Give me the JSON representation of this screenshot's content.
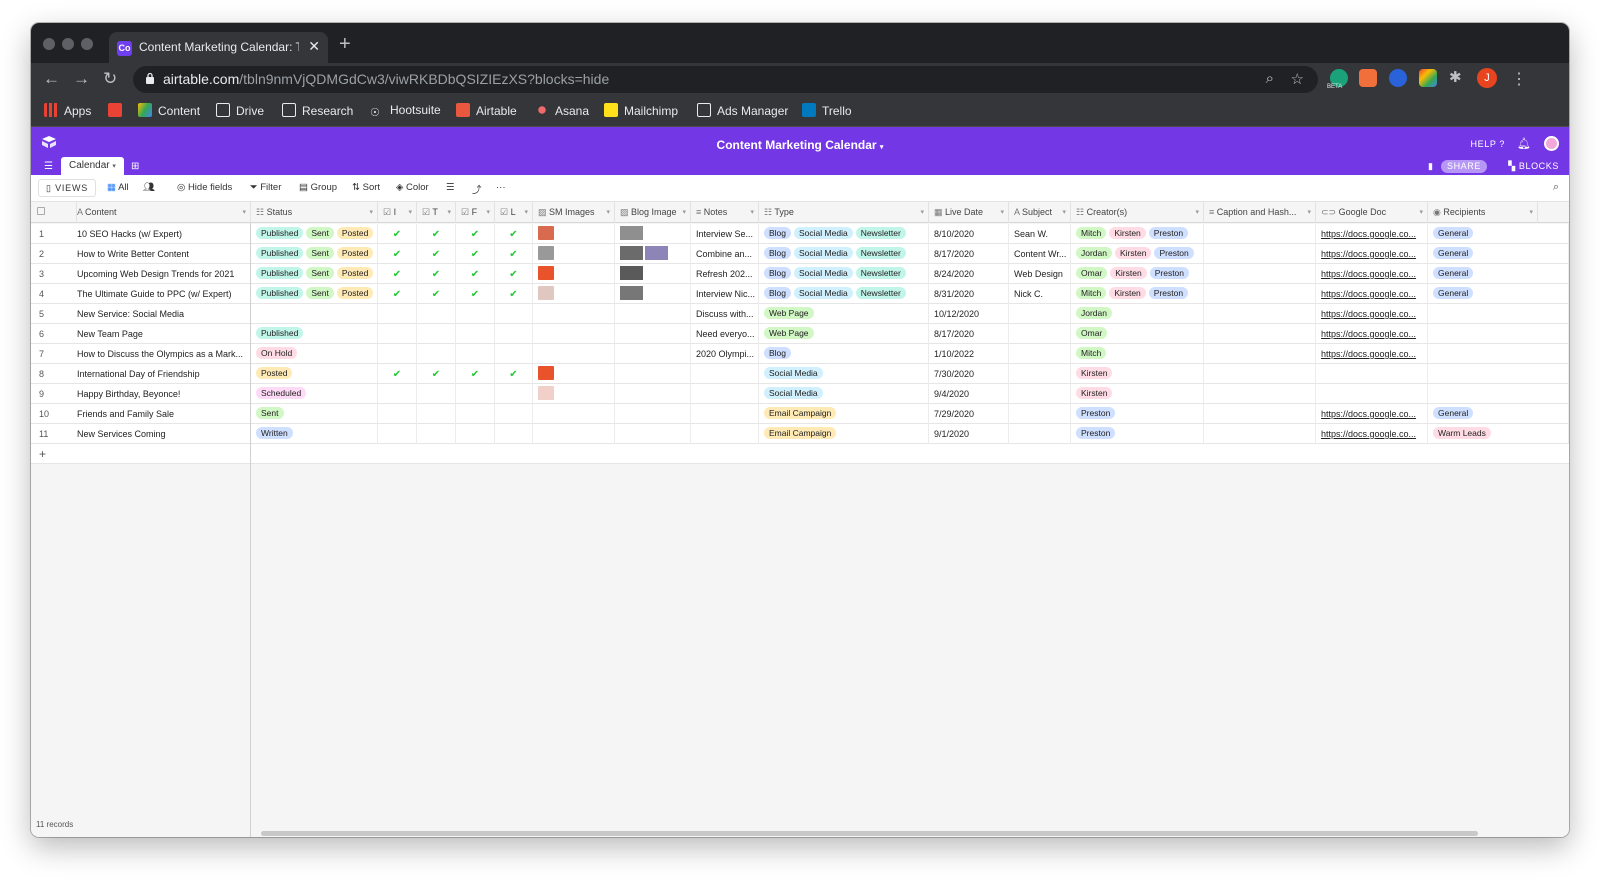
{
  "browser": {
    "tab_title": "Content Marketing Calendar: T",
    "tab_favicon": "Co",
    "url_host": "airtable.com",
    "url_path": "/tbln9nmVjQDMGdCw3/viwRKBDbQSIZIEzXS?blocks=hide",
    "profile_initial": "J",
    "ext_beta": "BETA",
    "bookmarks": [
      "Apps",
      "Content",
      "Drive",
      "Research",
      "Hootsuite",
      "Airtable",
      "Asana",
      "Mailchimp",
      "Ads Manager",
      "Trello"
    ]
  },
  "app": {
    "base_title": "Content Marketing Calendar",
    "help_label": "HELP",
    "table_tab": "Calendar",
    "share_label": "SHARE",
    "blocks_label": "BLOCKS",
    "accent": "#7437e6"
  },
  "viewbar": {
    "views_label": "VIEWS",
    "view_name": "All",
    "hide_fields": "Hide fields",
    "filter": "Filter",
    "group": "Group",
    "sort": "Sort",
    "color": "Color"
  },
  "columns": {
    "content": "Content",
    "status": "Status",
    "c_i": "I",
    "c_t": "T",
    "c_f": "F",
    "c_l": "L",
    "sm_images": "SM Images",
    "blog_image": "Blog Image",
    "notes": "Notes",
    "type": "Type",
    "live_date": "Live Date",
    "subject": "Subject",
    "creators": "Creator(s)",
    "caption": "Caption and Hash...",
    "google_doc": "Google Doc",
    "recipients": "Recipients"
  },
  "pill_colors": {
    "Published": "#c2f5e9",
    "Sent": "#d1f7c4",
    "Posted": "#ffeab6",
    "On Hold": "#ffdce5",
    "Scheduled": "#ffdaf6",
    "Written": "#cfdfff",
    "Blog": "#cfdfff",
    "Social Media": "#d0f0fd",
    "Newsletter": "#c2f5e9",
    "Web Page": "#d1f7c4",
    "Email Campaign": "#ffeab6",
    "Mitch": "#d1f7c4",
    "Kirsten": "#ffdce5",
    "Preston": "#cfdfff",
    "Jordan": "#d1f7c4",
    "Omar": "#d1f7c4",
    "General": "#cfdfff",
    "Warm Leads": "#ffdce5"
  },
  "rows": [
    {
      "n": "1",
      "content": "10 SEO Hacks (w/ Expert)",
      "status": [
        "Published",
        "Sent",
        "Posted"
      ],
      "i": true,
      "t": true,
      "f": true,
      "l": true,
      "sm": "#d86a4f",
      "blog": [
        "#8f8f8f"
      ],
      "notes": "Interview Se...",
      "type": [
        "Blog",
        "Social Media",
        "Newsletter"
      ],
      "date": "8/10/2020",
      "subject": "Sean W.",
      "creators": [
        "Mitch",
        "Kirsten",
        "Preston"
      ],
      "doc": "https://docs.google.co...",
      "recipients": [
        "General"
      ]
    },
    {
      "n": "2",
      "content": "How to Write Better Content",
      "status": [
        "Published",
        "Sent",
        "Posted"
      ],
      "i": true,
      "t": true,
      "f": true,
      "l": true,
      "sm": "#999999",
      "blog": [
        "#6b6b6b",
        "#8d84b8"
      ],
      "notes": "Combine an...",
      "type": [
        "Blog",
        "Social Media",
        "Newsletter"
      ],
      "date": "8/17/2020",
      "subject": "Content Wr...",
      "creators": [
        "Jordan",
        "Kirsten",
        "Preston"
      ],
      "doc": "https://docs.google.co...",
      "recipients": [
        "General"
      ]
    },
    {
      "n": "3",
      "content": "Upcoming Web Design Trends for 2021",
      "status": [
        "Published",
        "Sent",
        "Posted"
      ],
      "i": true,
      "t": true,
      "f": true,
      "l": true,
      "sm": "#e8532b",
      "blog": [
        "#5a5a5a"
      ],
      "notes": "Refresh 202...",
      "type": [
        "Blog",
        "Social Media",
        "Newsletter"
      ],
      "date": "8/24/2020",
      "subject": "Web Design",
      "creators": [
        "Omar",
        "Kirsten",
        "Preston"
      ],
      "doc": "https://docs.google.co...",
      "recipients": [
        "General"
      ]
    },
    {
      "n": "4",
      "content": "The Ultimate Guide to PPC (w/ Expert)",
      "status": [
        "Published",
        "Sent",
        "Posted"
      ],
      "i": true,
      "t": true,
      "f": true,
      "l": true,
      "sm": "#e0c7c0",
      "blog": [
        "#777777"
      ],
      "notes": "Interview Nic...",
      "type": [
        "Blog",
        "Social Media",
        "Newsletter"
      ],
      "date": "8/31/2020",
      "subject": "Nick C.",
      "creators": [
        "Mitch",
        "Kirsten",
        "Preston"
      ],
      "doc": "https://docs.google.co...",
      "recipients": [
        "General"
      ]
    },
    {
      "n": "5",
      "content": "New Service: Social Media",
      "status": [],
      "notes": "Discuss with...",
      "type": [
        "Web Page"
      ],
      "date": "10/12/2020",
      "creators": [
        "Jordan"
      ],
      "doc": "https://docs.google.co...",
      "recipients": []
    },
    {
      "n": "6",
      "content": "New Team Page",
      "status": [
        "Published"
      ],
      "notes": "Need everyo...",
      "type": [
        "Web Page"
      ],
      "date": "8/17/2020",
      "creators": [
        "Omar"
      ],
      "doc": "https://docs.google.co...",
      "recipients": []
    },
    {
      "n": "7",
      "content": "How to Discuss the Olympics as a Mark...",
      "status": [
        "On Hold"
      ],
      "notes": "2020 Olympi...",
      "type": [
        "Blog"
      ],
      "date": "1/10/2022",
      "creators": [
        "Mitch"
      ],
      "doc": "https://docs.google.co...",
      "recipients": []
    },
    {
      "n": "8",
      "content": "International Day of Friendship",
      "status": [
        "Posted"
      ],
      "i": true,
      "t": true,
      "f": true,
      "l": true,
      "sm": "#e8532b",
      "notes": "",
      "type": [
        "Social Media"
      ],
      "date": "7/30/2020",
      "creators": [
        "Kirsten"
      ],
      "doc": "",
      "recipients": []
    },
    {
      "n": "9",
      "content": "Happy Birthday, Beyonce!",
      "status": [
        "Scheduled"
      ],
      "sm": "#f0d0c8",
      "notes": "",
      "type": [
        "Social Media"
      ],
      "date": "9/4/2020",
      "creators": [
        "Kirsten"
      ],
      "doc": "",
      "recipients": []
    },
    {
      "n": "10",
      "content": "Friends and Family Sale",
      "status": [
        "Sent"
      ],
      "notes": "",
      "type": [
        "Email Campaign"
      ],
      "date": "7/29/2020",
      "creators": [
        "Preston"
      ],
      "doc": "https://docs.google.co...",
      "recipients": [
        "General"
      ]
    },
    {
      "n": "11",
      "content": "New Services Coming",
      "status": [
        "Written"
      ],
      "notes": "",
      "type": [
        "Email Campaign"
      ],
      "date": "9/1/2020",
      "creators": [
        "Preston"
      ],
      "doc": "https://docs.google.co...",
      "recipients": [
        "Warm Leads"
      ]
    }
  ],
  "footer": {
    "records": "11 records"
  }
}
